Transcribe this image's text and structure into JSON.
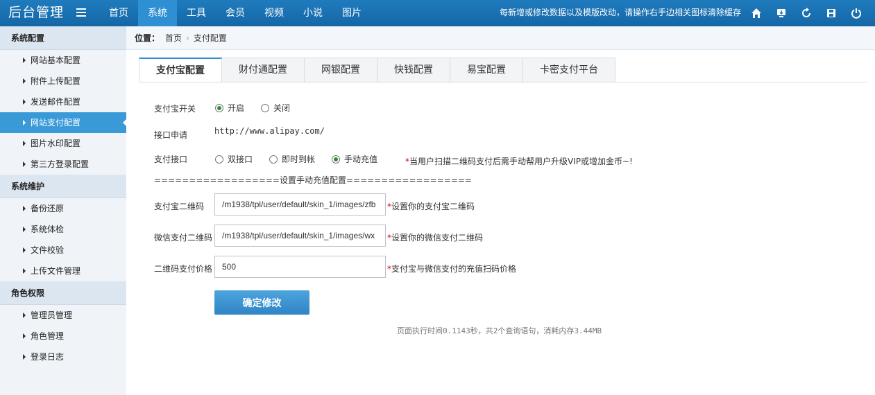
{
  "header": {
    "logo": "后台管理",
    "nav": [
      "首页",
      "系统",
      "工具",
      "会员",
      "视频",
      "小说",
      "图片"
    ],
    "active_nav": 1,
    "notice": "每新增或修改数据以及模版改动，请操作右手边相关图标清除缓存",
    "icons": [
      "home-icon",
      "download-icon",
      "refresh-icon",
      "save-icon",
      "power-icon"
    ]
  },
  "sidebar": {
    "groups": [
      {
        "title": "系统配置",
        "items": [
          "网站基本配置",
          "附件上传配置",
          "发送邮件配置",
          "网站支付配置",
          "图片水印配置",
          "第三方登录配置"
        ]
      },
      {
        "title": "系统维护",
        "items": [
          "备份还原",
          "系统体检",
          "文件校验",
          "上传文件管理"
        ]
      },
      {
        "title": "角色权限",
        "items": [
          "管理员管理",
          "角色管理",
          "登录日志"
        ]
      }
    ],
    "active_item": "网站支付配置"
  },
  "breadcrumb": {
    "label": "位置：",
    "home": "首页",
    "separator": "›",
    "current": "支付配置"
  },
  "tabs": {
    "items": [
      "支付宝配置",
      "财付通配置",
      "网银配置",
      "快钱配置",
      "易宝配置",
      "卡密支付平台"
    ],
    "active": 0
  },
  "form": {
    "switch": {
      "label": "支付宝开关",
      "options": [
        "开启",
        "关闭"
      ],
      "selected": 0
    },
    "apply": {
      "label": "接口申请",
      "url": "http://www.alipay.com/"
    },
    "interface": {
      "label": "支付接口",
      "options": [
        "双接口",
        "即时到帐",
        "手动充值"
      ],
      "selected": 2,
      "hint_star": "*",
      "hint": "当用户扫描二维码支付后需手动帮用户升级VIP或增加金币~!"
    },
    "divider": "==================设置手动充值配置==================",
    "alipay_qr": {
      "label": "支付宝二维码",
      "value": "/m1938/tpl/user/default/skin_1/images/zfb",
      "hint_star": "*",
      "hint": "设置你的支付宝二维码"
    },
    "wechat_qr": {
      "label": "微信支付二维码",
      "value": "/m1938/tpl/user/default/skin_1/images/wx",
      "hint_star": "*",
      "hint": "设置你的微信支付二维码"
    },
    "qr_price": {
      "label": "二维码支付价格",
      "value": "500",
      "hint_star": "*",
      "hint": "支付宝与微信支付的充值扫码价格"
    },
    "submit_label": "确定修改"
  },
  "footer": {
    "stats": "页面执行时间0.1143秒，共2个查询语句，消耗内存3.44MB"
  },
  "colors": {
    "header": "#1a70b0",
    "accent": "#3a9ad8",
    "sidebar_bg": "#f0f4f8",
    "required": "#dd0000",
    "radio_checked": "#2c8d2c"
  }
}
